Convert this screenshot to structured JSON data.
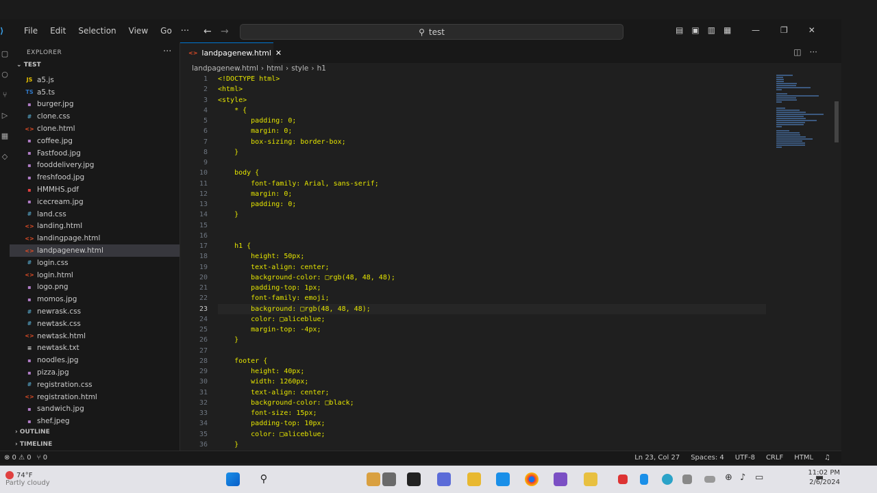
{
  "menu": [
    "File",
    "Edit",
    "Selection",
    "View",
    "Go"
  ],
  "search": {
    "label": "test"
  },
  "sidebar": {
    "title": "EXPLORER",
    "folder": "TEST",
    "files": [
      {
        "name": "a5.js",
        "icon": "JS",
        "color": "#e6c000"
      },
      {
        "name": "a5.ts",
        "icon": "TS",
        "color": "#3178c6"
      },
      {
        "name": "burger.jpg",
        "icon": "▪",
        "color": "#b07cc6"
      },
      {
        "name": "clone.css",
        "icon": "#",
        "color": "#519aba"
      },
      {
        "name": "clone.html",
        "icon": "<>",
        "color": "#e44d26"
      },
      {
        "name": "coffee.jpg",
        "icon": "▪",
        "color": "#b07cc6"
      },
      {
        "name": "Fastfood.jpg",
        "icon": "▪",
        "color": "#b07cc6"
      },
      {
        "name": "fooddelivery.jpg",
        "icon": "▪",
        "color": "#b07cc6"
      },
      {
        "name": "freshfood.jpg",
        "icon": "▪",
        "color": "#b07cc6"
      },
      {
        "name": "HMMHS.pdf",
        "icon": "▪",
        "color": "#e04040"
      },
      {
        "name": "icecream.jpg",
        "icon": "▪",
        "color": "#b07cc6"
      },
      {
        "name": "land.css",
        "icon": "#",
        "color": "#519aba"
      },
      {
        "name": "landing.html",
        "icon": "<>",
        "color": "#e44d26"
      },
      {
        "name": "landingpage.html",
        "icon": "<>",
        "color": "#e44d26"
      },
      {
        "name": "landpagenew.html",
        "icon": "<>",
        "color": "#e44d26",
        "active": true
      },
      {
        "name": "login.css",
        "icon": "#",
        "color": "#519aba"
      },
      {
        "name": "login.html",
        "icon": "<>",
        "color": "#e44d26"
      },
      {
        "name": "logo.png",
        "icon": "▪",
        "color": "#b07cc6"
      },
      {
        "name": "momos.jpg",
        "icon": "▪",
        "color": "#b07cc6"
      },
      {
        "name": "newrask.css",
        "icon": "#",
        "color": "#519aba"
      },
      {
        "name": "newtask.css",
        "icon": "#",
        "color": "#519aba"
      },
      {
        "name": "newtask.html",
        "icon": "<>",
        "color": "#e44d26"
      },
      {
        "name": "newtask.txt",
        "icon": "≡",
        "color": "#cccccc"
      },
      {
        "name": "noodles.jpg",
        "icon": "▪",
        "color": "#b07cc6"
      },
      {
        "name": "pizza.jpg",
        "icon": "▪",
        "color": "#b07cc6"
      },
      {
        "name": "registration.css",
        "icon": "#",
        "color": "#519aba"
      },
      {
        "name": "registration.html",
        "icon": "<>",
        "color": "#e44d26"
      },
      {
        "name": "sandwich.jpg",
        "icon": "▪",
        "color": "#b07cc6"
      },
      {
        "name": "shef.jpeg",
        "icon": "▪",
        "color": "#b07cc6"
      }
    ],
    "outline": "OUTLINE",
    "timeline": "TIMELINE"
  },
  "tab": {
    "label": "landpagenew.html"
  },
  "breadcrumb": [
    "landpagenew.html",
    "html",
    "style",
    "h1"
  ],
  "current_line": 23,
  "code_lines": [
    "<!DOCTYPE html>",
    "<html>",
    "<style>",
    "    * {",
    "        padding: 0;",
    "        margin: 0;",
    "        box-sizing: border-box;",
    "    }",
    "",
    "    body {",
    "        font-family: Arial, sans-serif;",
    "        margin: 0;",
    "        padding: 0;",
    "    }",
    "",
    "",
    "    h1 {",
    "        height: 50px;",
    "        text-align: center;",
    "        background-color: □rgb(48, 48, 48);",
    "        padding-top: 1px;",
    "        font-family: emoji;",
    "        background: □rgb(48, 48, 48);",
    "        color: □aliceblue;",
    "        margin-top: -4px;",
    "    }",
    "",
    "    footer {",
    "        height: 40px;",
    "        width: 1260px;",
    "        text-align: center;",
    "        background-color: □black;",
    "        font-size: 15px;",
    "        padding-top: 10px;",
    "        color: □aliceblue;",
    "    }"
  ],
  "status": {
    "errors": "⊗ 0 ⚠ 0",
    "ports": "⑂ 0",
    "position": "Ln 23, Col 27",
    "spaces": "Spaces: 4",
    "encoding": "UTF-8",
    "eol": "CRLF",
    "language": "HTML"
  },
  "taskbar": {
    "temp": "74°F",
    "weather": "Partly cloudy",
    "time": "11:02 PM",
    "date": "2/6/2024"
  }
}
